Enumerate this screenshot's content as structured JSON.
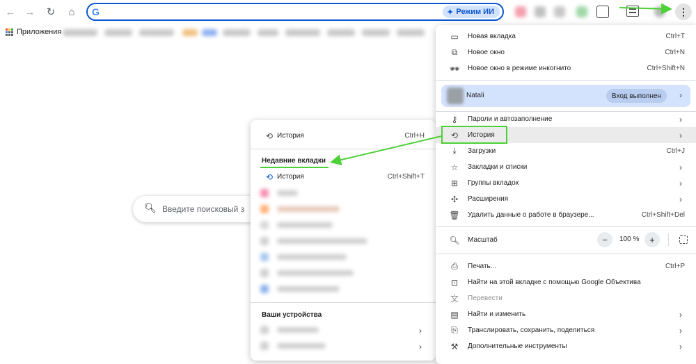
{
  "toolbar": {
    "back_icon": "arrow-left-icon",
    "forward_icon": "arrow-right-icon",
    "reload_icon": "reload-icon",
    "home_icon": "home-icon",
    "ai_mode_label": "Режим ИИ",
    "kebab_icon": "kebab-menu-icon"
  },
  "bookmarks": {
    "apps_label": "Приложения"
  },
  "page_search": {
    "placeholder": "Введите поисковый з"
  },
  "main_menu": {
    "new_tab": {
      "label": "Новая вкладка",
      "shortcut": "Ctrl+T"
    },
    "new_window": {
      "label": "Новое окно",
      "shortcut": "Ctrl+N"
    },
    "incognito": {
      "label": "Новое окно в режиме инкогнито",
      "shortcut": "Ctrl+Shift+N"
    },
    "profile": {
      "name": "Natali",
      "status": "Вход выполнен"
    },
    "passwords": {
      "label": "Пароли и автозаполнение"
    },
    "history": {
      "label": "История"
    },
    "downloads": {
      "label": "Загрузки",
      "shortcut": "Ctrl+J"
    },
    "bookmarks": {
      "label": "Закладки и списки"
    },
    "tab_groups": {
      "label": "Группы вкладок"
    },
    "extensions": {
      "label": "Расширения"
    },
    "clear_data": {
      "label": "Удалить данные о работе в браузере...",
      "shortcut": "Ctrl+Shift+Del"
    },
    "zoom": {
      "label": "Масштаб",
      "minus": "−",
      "value": "100 %",
      "plus": "+"
    },
    "print": {
      "label": "Печать...",
      "shortcut": "Ctrl+P"
    },
    "lens": {
      "label": "Найти на этой вкладке с помощью Google Объектива"
    },
    "translate": {
      "label": "Перевести"
    },
    "find_edit": {
      "label": "Найти и изменить"
    },
    "cast": {
      "label": "Транслировать, сохранить, поделиться"
    },
    "more_tools": {
      "label": "Дополнительные инструменты"
    }
  },
  "history_submenu": {
    "history": {
      "label": "История",
      "shortcut": "Ctrl+H"
    },
    "recent_tabs_title": "Недавние вкладки",
    "recent_history": {
      "label": "История",
      "shortcut": "Ctrl+Shift+T"
    },
    "devices_title": "Ваши устройства"
  },
  "colors": {
    "accent": "#0b57d0",
    "profile_bg": "#d3e3fd",
    "annotation_green": "#4cd137"
  }
}
